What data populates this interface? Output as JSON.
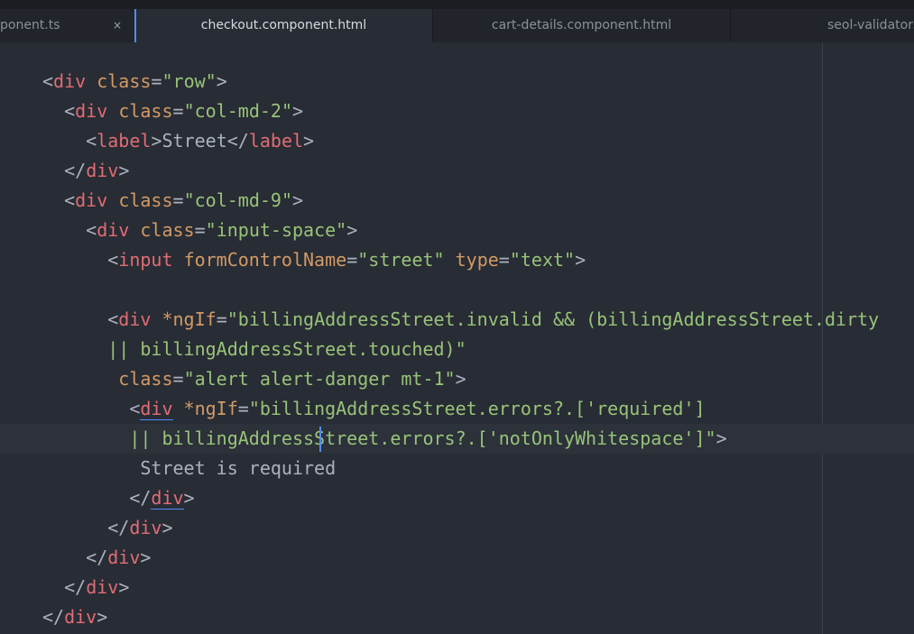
{
  "tabs": [
    {
      "label": "ponent.ts",
      "close": "×"
    },
    {
      "label": "checkout.component.html"
    },
    {
      "label": "cart-details.component.html"
    },
    {
      "label": "seol-validators"
    }
  ],
  "code": {
    "l1": {
      "lt": "<",
      "tag": "div",
      "attr": "class",
      "eq": "=",
      "val": "\"row\"",
      "gt": ">"
    },
    "l2": {
      "lt": "<",
      "tag": "div",
      "attr": "class",
      "eq": "=",
      "val": "\"col-md-2\"",
      "gt": ">"
    },
    "l3": {
      "lt": "<",
      "tag": "label",
      "gt": ">",
      "text": "Street",
      "lt2": "</",
      "tag2": "label",
      "gt2": ">"
    },
    "l4": {
      "lt": "</",
      "tag": "div",
      "gt": ">"
    },
    "l5": {
      "lt": "<",
      "tag": "div",
      "attr": "class",
      "eq": "=",
      "val": "\"col-md-9\"",
      "gt": ">"
    },
    "l6": {
      "lt": "<",
      "tag": "div",
      "attr": "class",
      "eq": "=",
      "val": "\"input-space\"",
      "gt": ">"
    },
    "l7": {
      "lt": "<",
      "tag": "input",
      "attr": "formControlName",
      "eq": "=",
      "val": "\"street\"",
      "attr2": "type",
      "eq2": "=",
      "val2": "\"text\"",
      "gt": ">"
    },
    "l9": {
      "lt": "<",
      "tag": "div",
      "attr": "*ngIf",
      "eq": "=",
      "val": "\"billingAddressStreet.invalid && (billingAddressStreet.dirty"
    },
    "l10": {
      "val": "|| billingAddressStreet.touched)\""
    },
    "l11": {
      "attr": "class",
      "eq": "=",
      "val": "\"alert alert-danger mt-1\"",
      "gt": ">"
    },
    "l12": {
      "lt": "<",
      "tag": "div",
      "attr": "*ngIf",
      "eq": "=",
      "val": "\"billingAddressStreet.errors?.['required']"
    },
    "l13": {
      "val_a": "|| billingAddress",
      "val_b": "Street.errors?.['notOnlyWhitespace']\"",
      "gt": ">"
    },
    "l14": {
      "text": "Street is required"
    },
    "l15": {
      "lt": "</",
      "tag": "div",
      "gt": ">"
    },
    "l16": {
      "lt": "</",
      "tag": "div",
      "gt": ">"
    },
    "l17": {
      "lt": "</",
      "tag": "div",
      "gt": ">"
    },
    "l18": {
      "lt": "</",
      "tag": "div",
      "gt": ">"
    },
    "l19": {
      "lt": "</",
      "tag": "div",
      "gt": ">"
    }
  },
  "colors": {
    "background": "#282c34",
    "tag": "#e06c75",
    "attribute": "#d19a66",
    "string": "#98c379",
    "text": "#abb2bf",
    "accent": "#568af2"
  }
}
